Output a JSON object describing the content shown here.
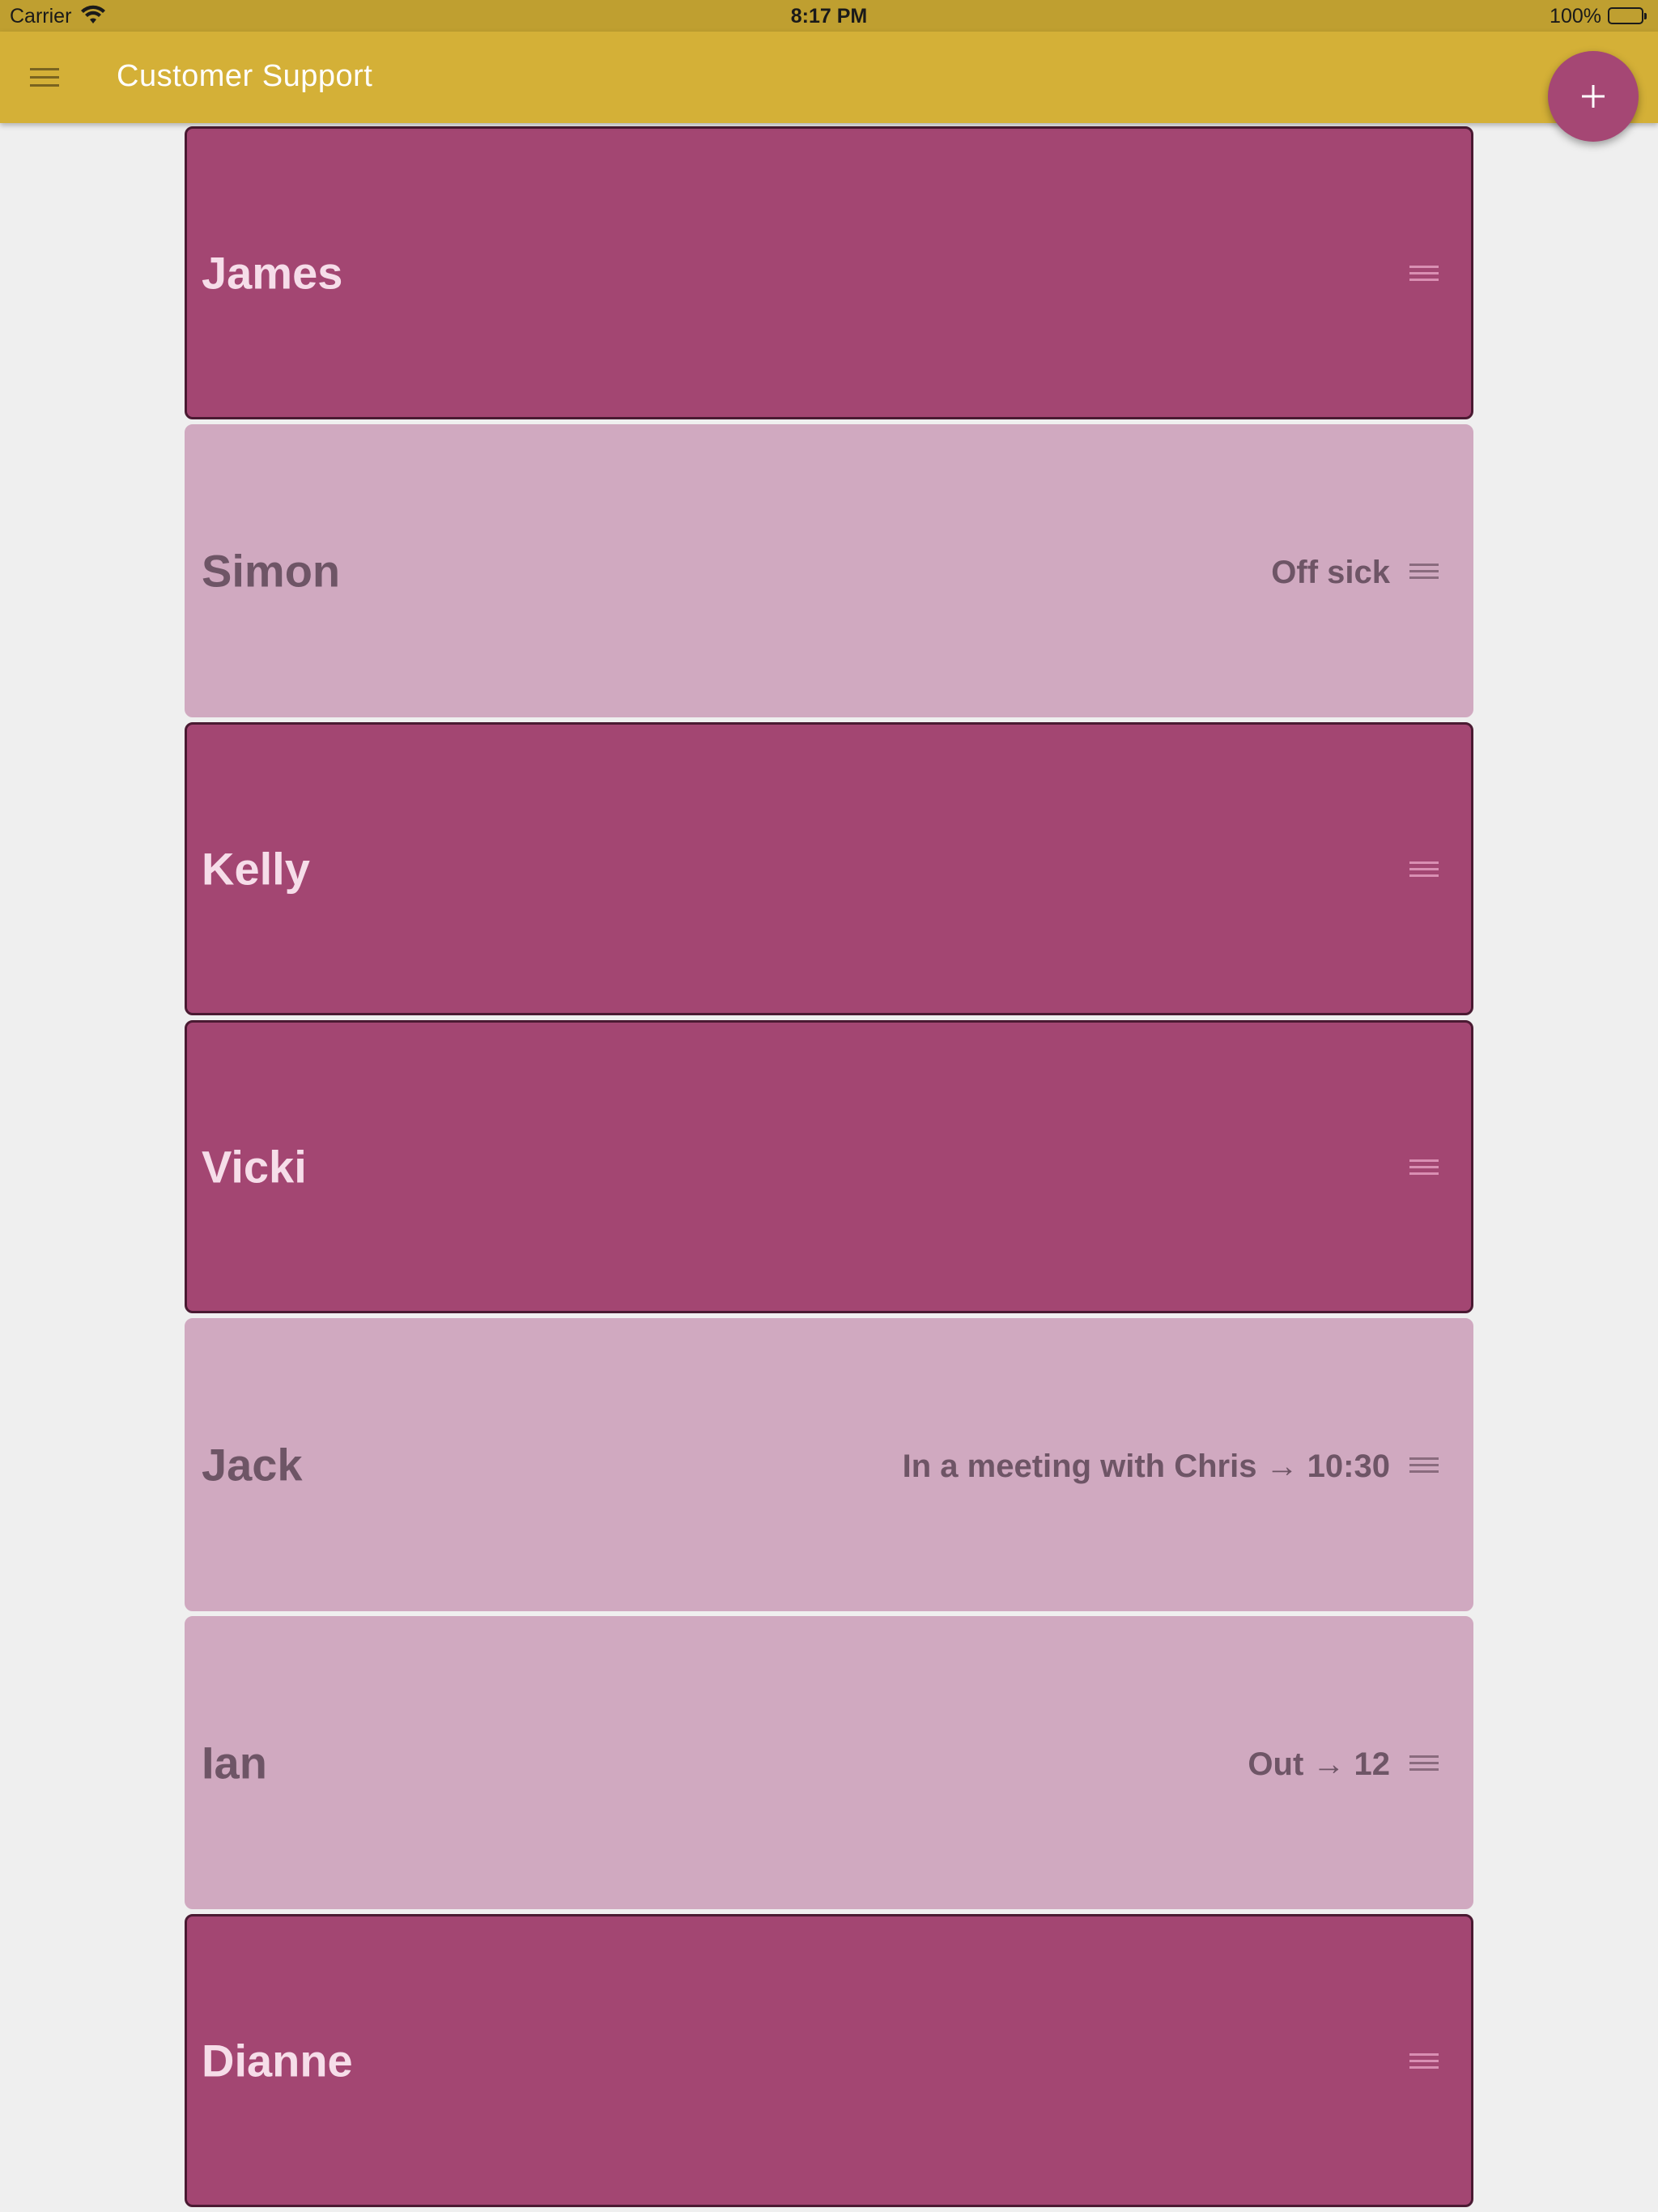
{
  "status_bar": {
    "carrier": "Carrier",
    "time": "8:17 PM",
    "battery": "100%"
  },
  "app_bar": {
    "title": "Customer Support",
    "fab_icon": "plus-icon",
    "menu_icon": "hamburger-menu-icon"
  },
  "colors": {
    "app_bar": "#d4b037",
    "status_bar": "#bf9f30",
    "accent": "#a54774",
    "card_active": "#a34672",
    "card_away": "#d0a9c0"
  },
  "staff": [
    {
      "name": "James",
      "status": "",
      "state": "active"
    },
    {
      "name": "Simon",
      "status": "Off sick",
      "state": "away"
    },
    {
      "name": "Kelly",
      "status": "",
      "state": "active"
    },
    {
      "name": "Vicki",
      "status": "",
      "state": "active"
    },
    {
      "name": "Jack",
      "status": "In a meeting with Chris → 10:30",
      "state": "away"
    },
    {
      "name": "Ian",
      "status": "Out → 12",
      "state": "away"
    },
    {
      "name": "Dianne",
      "status": "",
      "state": "active"
    }
  ]
}
